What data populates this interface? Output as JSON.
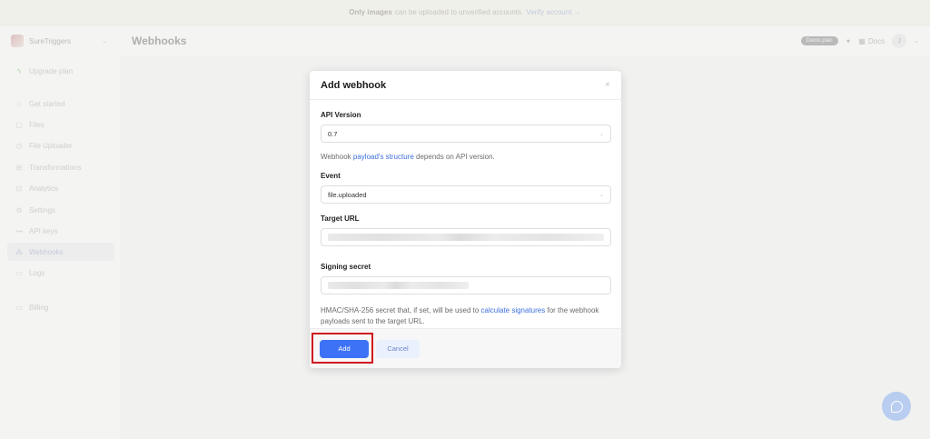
{
  "banner": {
    "bold": "Only images",
    "text": "can be uploaded to unverified accounts.",
    "link": "Verify account →"
  },
  "app": {
    "brand": "SureTriggers",
    "page_title": "Webhooks",
    "plan_badge": "Demo plan",
    "docs_label": "Docs",
    "avatar_initial": "J"
  },
  "sidebar": {
    "upgrade": "Upgrade plan",
    "items": [
      {
        "label": "Get started",
        "icon": "☆"
      },
      {
        "label": "Files",
        "icon": "▢"
      },
      {
        "label": "File Uploader",
        "icon": "◷"
      },
      {
        "label": "Transformations",
        "icon": "⊞"
      },
      {
        "label": "Analytics",
        "icon": "⊡"
      },
      {
        "label": "Settings",
        "icon": "⚙"
      },
      {
        "label": "API keys",
        "icon": "⊶"
      },
      {
        "label": "Webhooks",
        "icon": "⁂"
      },
      {
        "label": "Logs",
        "icon": "▭"
      },
      {
        "label": "Billing",
        "icon": "▭"
      }
    ]
  },
  "modal": {
    "title": "Add webhook",
    "close_icon": "×",
    "api_version_label": "API Version",
    "api_version_value": "0.7",
    "help_pre": "Webhook",
    "help_link": "payload's structure",
    "help_post": "depends on API version.",
    "event_label": "Event",
    "event_value": "file.uploaded",
    "target_url_label": "Target URL",
    "signing_secret_label": "Signing secret",
    "secret_help_pre": "HMAC/SHA-256 secret that, if set, will be used to",
    "secret_help_link": "calculate signatures",
    "secret_help_post": "for the webhook payloads sent to the target URL.",
    "add_button": "Add",
    "cancel_button": "Cancel"
  },
  "colors": {
    "accent": "#3e72f6",
    "link": "#3d6fe0",
    "highlight": "#d0171e"
  }
}
